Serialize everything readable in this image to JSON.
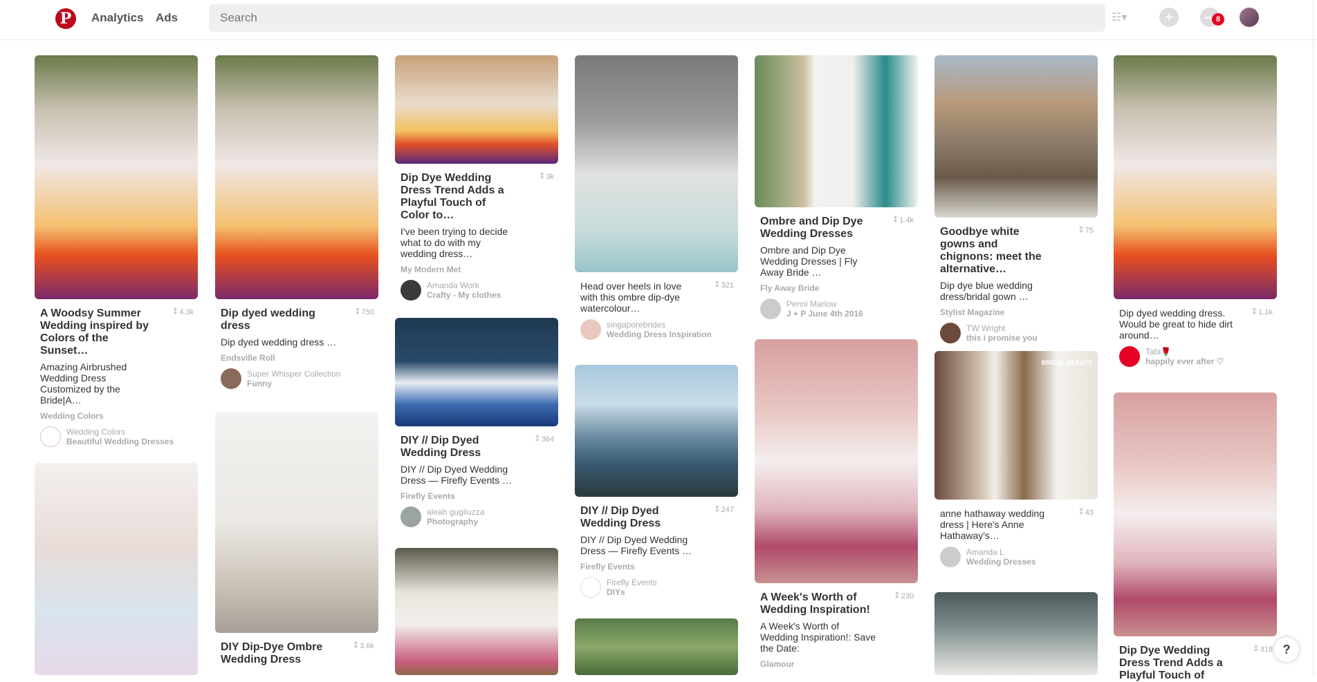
{
  "header": {
    "logo": "P",
    "nav": [
      "Analytics",
      "Ads"
    ],
    "search_placeholder": "Search",
    "notifications_count": "8",
    "icons": [
      "pinterest-logo-icon",
      "list-view-icon",
      "add-icon",
      "messages-icon",
      "profile-avatar"
    ]
  },
  "pins": [
    {
      "title": "A Woodsy Summer Wedding inspired by Colors of the Sunset…",
      "count": "4.3k",
      "desc": "Amazing Airbrushed Wedding Dress Customized by the Bride|A…",
      "source": "Wedding Colors",
      "pinner": "Wedding Colors",
      "board": "Beautiful Wedding Dresses"
    },
    {
      "title": "",
      "count": "",
      "desc": "",
      "source": "",
      "pinner": "",
      "board": ""
    },
    {
      "title": "Dip dyed wedding dress",
      "count": "750",
      "desc": "Dip dyed wedding dress …",
      "source": "Endsville Roll",
      "pinner": "Super Whisper Collection",
      "board": "Funny"
    },
    {
      "title": "DIY Dip-Dye Ombre Wedding Dress",
      "count": "3.6k",
      "desc": "",
      "source": "",
      "pinner": "",
      "board": ""
    },
    {
      "title": "Dip Dye Wedding Dress Trend Adds a Playful Touch of Color to…",
      "count": "3k",
      "desc": "I've been trying to decide what to do with my wedding dress…",
      "source": "My Modern Met",
      "pinner": "Amanda Work",
      "board": "Crafty - My clothes"
    },
    {
      "title": "DIY // Dip Dyed Wedding Dress",
      "count": "364",
      "desc": "DIY // Dip Dyed Wedding Dress — Firefly Events …",
      "source": "Firefly Events",
      "pinner": "aleah gugliuzza",
      "board": "Photography"
    },
    {
      "title": "",
      "count": "",
      "desc": "",
      "source": "",
      "pinner": "",
      "board": ""
    },
    {
      "title": "",
      "count": "321",
      "desc": "Head over heels in love with this ombre dip-dye watercolour…",
      "source": "",
      "pinner": "singaporebrides",
      "board": "Wedding Dress Inspiration"
    },
    {
      "title": "DIY // Dip Dyed Wedding Dress",
      "count": "247",
      "desc": "DIY // Dip Dyed Wedding Dress — Firefly Events …",
      "source": "Firefly Events",
      "pinner": "Firefly Events",
      "board": "DIYs"
    },
    {
      "title": "",
      "count": "",
      "desc": "",
      "source": "",
      "pinner": "",
      "board": ""
    },
    {
      "title": "Ombre and Dip Dye Wedding Dresses",
      "count": "1.4k",
      "desc": "Ombre and Dip Dye Wedding Dresses | Fly Away Bride …",
      "source": "Fly Away Bride",
      "pinner": "Penni Marlow",
      "board": "J + P June 4th 2016"
    },
    {
      "title": "A Week's Worth of Wedding Inspiration!",
      "count": "230",
      "desc": "A Week's Worth of Wedding Inspiration!: Save the Date:",
      "source": "Glamour",
      "pinner": "",
      "board": ""
    },
    {
      "title": "Goodbye white gowns and chignons: meet the alternative…",
      "count": "75",
      "desc": "Dip dye blue wedding dress/bridal gown …",
      "source": "Stylist Magazine",
      "pinner": "TW Wright",
      "board": "this i promise you"
    },
    {
      "title": "",
      "count": "43",
      "desc": "anne hathaway wedding dress | Here's Anne Hathaway's…",
      "source": "",
      "pinner": "Amanda L",
      "board": "Wedding Dresses"
    },
    {
      "title": "",
      "count": "",
      "desc": "",
      "source": "",
      "pinner": "",
      "board": ""
    },
    {
      "title": "",
      "count": "1.1k",
      "desc": "Dip dyed wedding dress. Would be great to hide dirt around…",
      "source": "",
      "pinner": "Tabi🌹",
      "board": "happily ever after ♡"
    },
    {
      "title": "Dip Dye Wedding Dress Trend Adds a Playful Touch of",
      "count": "318",
      "desc": "",
      "source": "",
      "pinner": "",
      "board": ""
    }
  ],
  "overlay": {
    "bridal_beauty": "BRIDAL BEAUTY"
  },
  "help": "?",
  "colors": {
    "brand": "#bd081c",
    "badge": "#e60023"
  }
}
